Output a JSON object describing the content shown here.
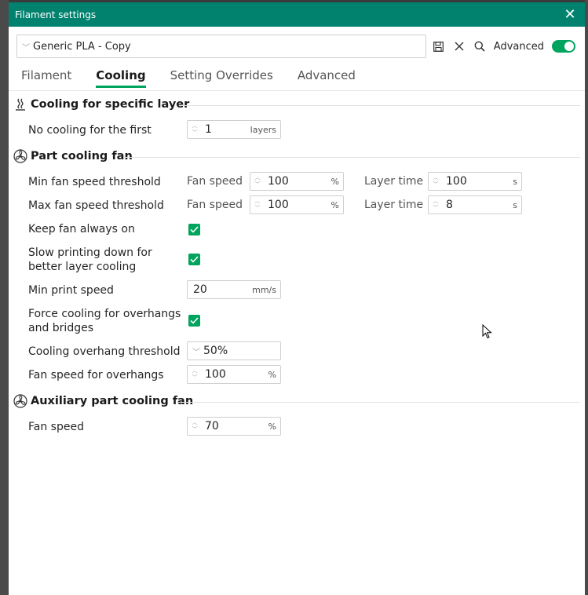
{
  "window": {
    "title": "Filament settings",
    "close_glyph": "✕"
  },
  "preset": {
    "name": "Generic PLA - Copy",
    "advanced_label": "Advanced",
    "advanced_on": true
  },
  "tabs": [
    {
      "label": "Filament",
      "active": false
    },
    {
      "label": "Cooling",
      "active": true
    },
    {
      "label": "Setting Overrides",
      "active": false
    },
    {
      "label": "Advanced",
      "active": false
    }
  ],
  "sections": {
    "specific_layer": {
      "title": "Cooling for specific layer",
      "no_cooling": {
        "label": "No cooling for the first",
        "value": "1",
        "unit": "layers"
      }
    },
    "part_fan": {
      "title": "Part cooling fan",
      "min_fan": {
        "label": "Min fan speed threshold",
        "fan_label": "Fan speed",
        "fan_value": "100",
        "fan_unit": "%",
        "time_label": "Layer time",
        "time_value": "100",
        "time_unit": "s"
      },
      "max_fan": {
        "label": "Max fan speed threshold",
        "fan_label": "Fan speed",
        "fan_value": "100",
        "fan_unit": "%",
        "time_label": "Layer time",
        "time_value": "8",
        "time_unit": "s"
      },
      "keep_fan": {
        "label": "Keep fan always on",
        "checked": true
      },
      "slow_down": {
        "label_line1": "Slow printing down for",
        "label_line2": "better layer cooling",
        "checked": true
      },
      "min_print_speed": {
        "label": "Min print speed",
        "value": "20",
        "unit": "mm/s"
      },
      "force_cooling": {
        "label_line1": "Force cooling for overhangs",
        "label_line2": "and bridges",
        "checked": true
      },
      "overhang_threshold": {
        "label": "Cooling overhang threshold",
        "value": "50%"
      },
      "overhang_fan": {
        "label": "Fan speed for overhangs",
        "value": "100",
        "unit": "%"
      }
    },
    "aux_fan": {
      "title": "Auxiliary part cooling fan",
      "fan_speed": {
        "label": "Fan speed",
        "value": "70",
        "unit": "%"
      }
    }
  },
  "colors": {
    "titlebar": "#00826f",
    "accent": "#00a45e"
  },
  "icons": [
    "save-icon",
    "close-icon",
    "search-icon",
    "cooling-layer-icon",
    "fan-icon"
  ]
}
